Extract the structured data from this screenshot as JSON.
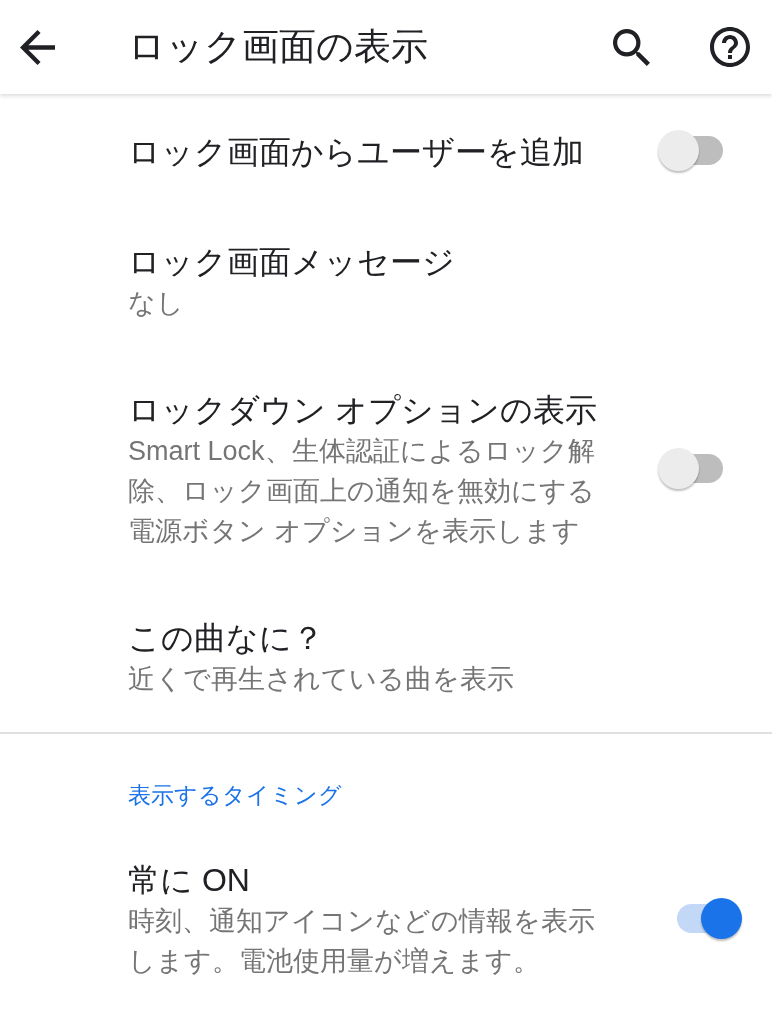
{
  "app_bar": {
    "title": "ロック画面の表示"
  },
  "sections": [
    {
      "items": [
        {
          "kind": "switch",
          "title": "ロック画面からユーザーを追加",
          "on": false
        },
        {
          "kind": "text",
          "title": "ロック画面メッセージ",
          "summary": "なし"
        },
        {
          "kind": "switch",
          "title": "ロックダウン オプションの表示",
          "summary": "Smart Lock、生体認証によるロック解除、ロック画面上の通知を無効にする電源ボタン オプションを表示します",
          "on": false
        },
        {
          "kind": "text",
          "title": "この曲なに？",
          "summary": "近くで再生されている曲を表示"
        }
      ]
    },
    {
      "header": "表示するタイミング",
      "items": [
        {
          "kind": "switch",
          "title": "常に ON",
          "summary": "時刻、通知アイコンなどの情報を表示します。電池使用量が増えます。",
          "on": true
        }
      ]
    }
  ]
}
